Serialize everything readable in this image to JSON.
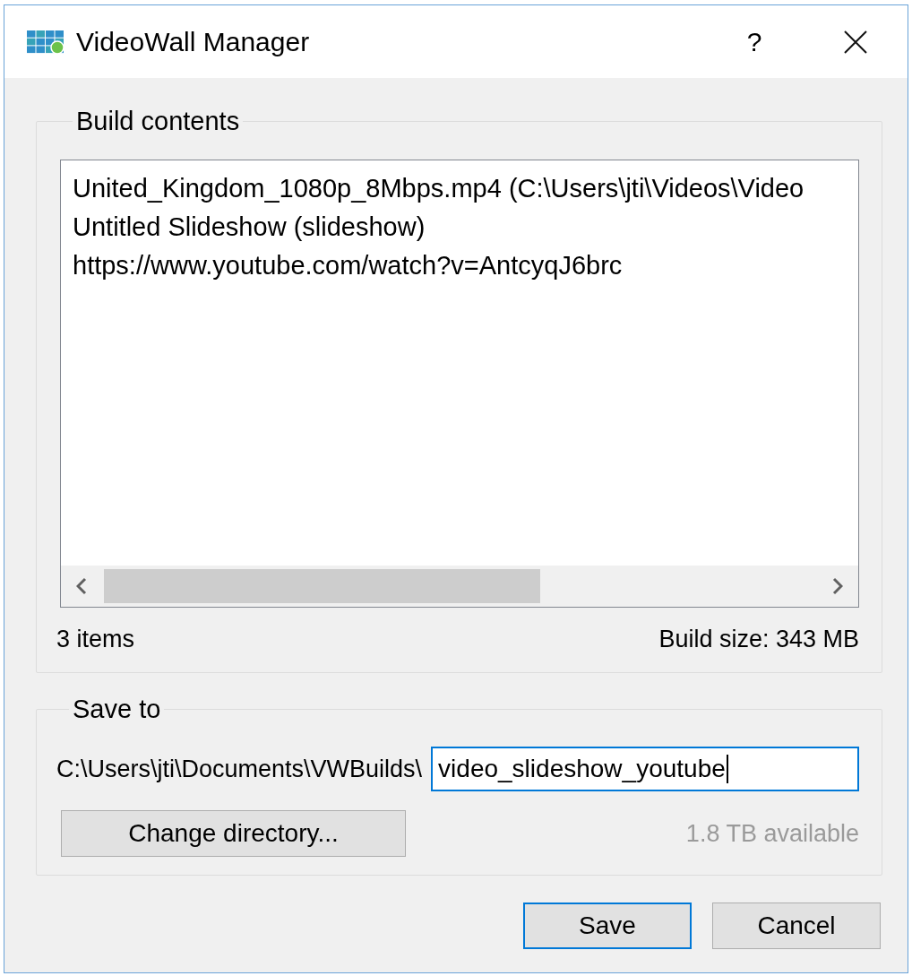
{
  "window": {
    "title": "VideoWall Manager",
    "help_button": "?"
  },
  "build_contents": {
    "title": "Build contents",
    "items": [
      "United_Kingdom_1080p_8Mbps.mp4 (C:\\Users\\jti\\Videos\\Video",
      "Untitled Slideshow (slideshow)",
      "https://www.youtube.com/watch?v=AntcyqJ6brc"
    ],
    "item_count": "3 items",
    "build_size": "Build size: 343 MB"
  },
  "save_to": {
    "title": "Save to",
    "directory": "C:\\Users\\jti\\Documents\\VWBuilds\\",
    "filename": "video_slideshow_youtube",
    "focused": true,
    "change_directory_button": "Change directory...",
    "available_space": "1.8 TB available"
  },
  "buttons": [
    {
      "label": "Save",
      "default": true
    },
    {
      "label": "Cancel",
      "default": false
    }
  ]
}
